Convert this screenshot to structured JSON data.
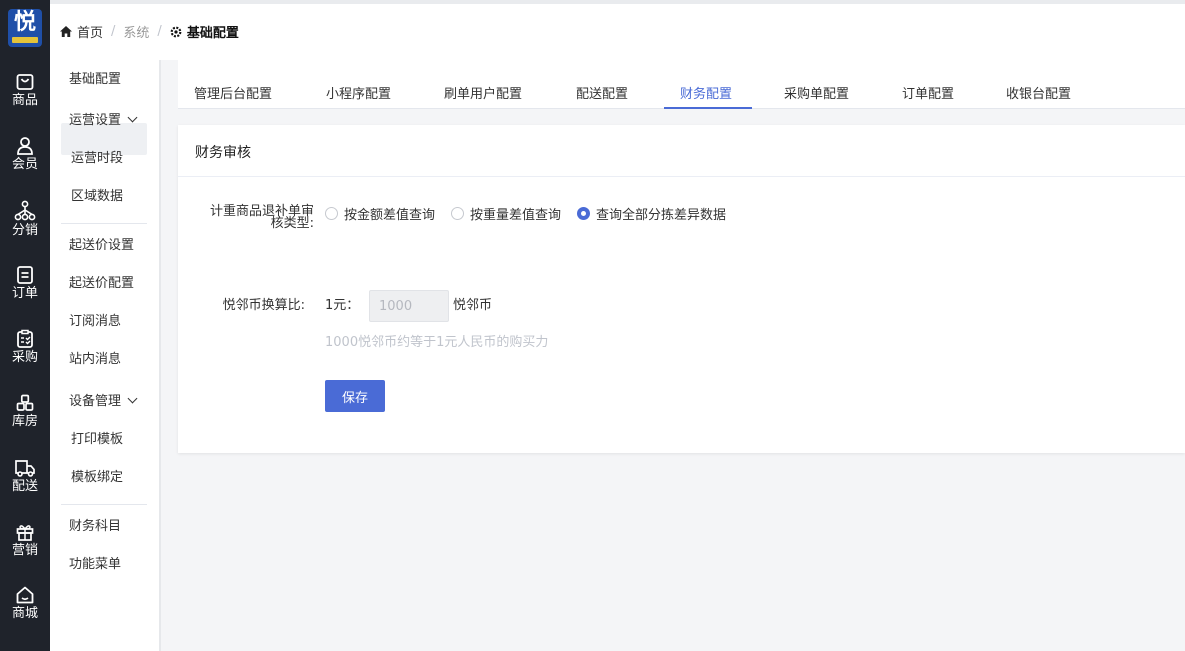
{
  "logo": {
    "char": "悦"
  },
  "rail": [
    {
      "label": "商品",
      "icon": "bag-icon"
    },
    {
      "label": "会员",
      "icon": "user-icon"
    },
    {
      "label": "分销",
      "icon": "network-icon"
    },
    {
      "label": "订单",
      "icon": "document-icon"
    },
    {
      "label": "采购",
      "icon": "clipboard-icon"
    },
    {
      "label": "库房",
      "icon": "warehouse-icon"
    },
    {
      "label": "配送",
      "icon": "delivery-icon"
    },
    {
      "label": "营销",
      "icon": "gift-icon"
    },
    {
      "label": "商城",
      "icon": "home-icon"
    }
  ],
  "breadcrumb": {
    "home": "首页",
    "system": "系统",
    "current": "基础配置",
    "home_icon": "home-icon",
    "gear_icon": "gear-icon"
  },
  "submenu": {
    "items": [
      "基础配置",
      "运营设置",
      "运营时段",
      "区域数据",
      "起送价设置",
      "起送价配置",
      "订阅消息",
      "站内消息",
      "设备管理",
      "打印模板",
      "模板绑定",
      "财务科目",
      "功能菜单"
    ]
  },
  "tabs": [
    "管理后台配置",
    "小程序配置",
    "刷单用户配置",
    "配送配置",
    "财务配置",
    "采购单配置",
    "订单配置",
    "收银台配置"
  ],
  "active_tab": "财务配置",
  "card": {
    "title": "财务审核",
    "audit_label_line1": "计重商品退补单审",
    "audit_label_line2": "核类型:",
    "options": [
      "按金额差值查询",
      "按重量差值查询",
      "查询全部分拣差异数据"
    ],
    "selected_option": "查询全部分拣差异数据",
    "rate_label": "悦邻币换算比:",
    "rate_prefix": "1元：",
    "rate_value": "1000",
    "rate_unit": "悦邻币",
    "hint": "1000悦邻币约等于1元人民币的购买力",
    "save_label": "保存"
  },
  "colors": {
    "rail_bg": "#1f232b",
    "accent": "#4a6bd6",
    "logo_bg": "#1f4fa8"
  }
}
